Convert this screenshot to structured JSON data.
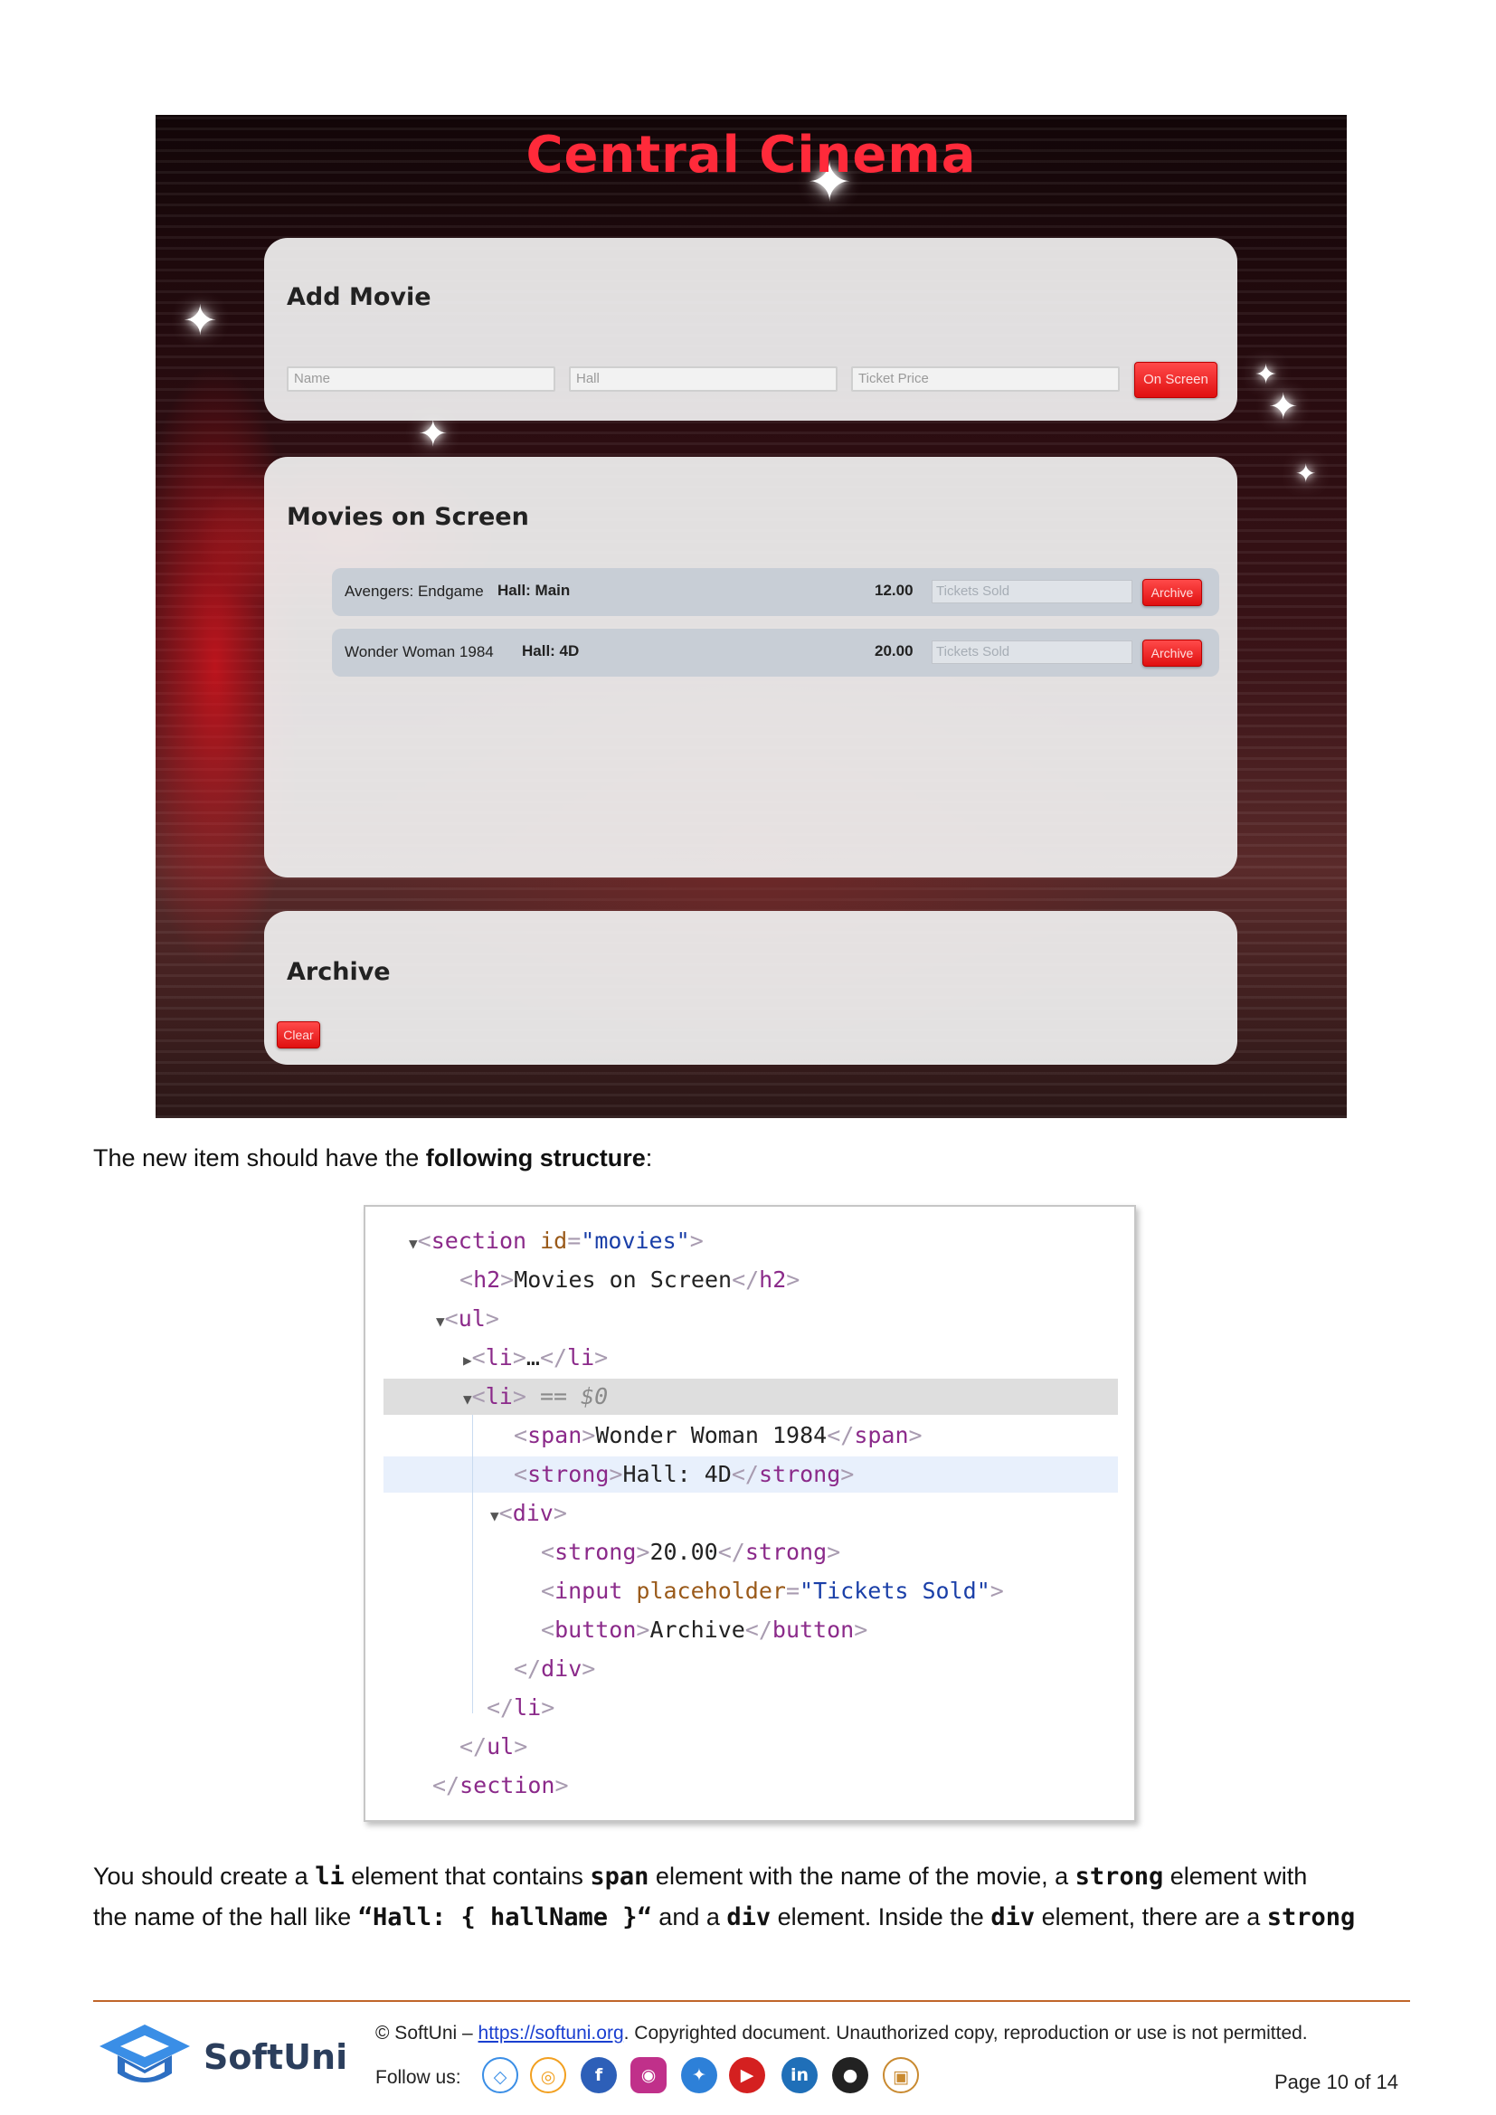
{
  "cinema_app": {
    "title": "Central Cinema",
    "add_movie": {
      "heading": "Add Movie",
      "name_placeholder": "Name",
      "hall_placeholder": "Hall",
      "price_placeholder": "Ticket Price",
      "on_screen_label": "On Screen"
    },
    "movies_on_screen": {
      "heading": "Movies on Screen",
      "movies": [
        {
          "name": "Avengers: Endgame",
          "hall": "Hall: Main",
          "price": "12.00",
          "tickets_placeholder": "Tickets Sold",
          "archive_label": "Archive"
        },
        {
          "name": "Wonder Woman 1984",
          "hall": "Hall: 4D",
          "price": "20.00",
          "tickets_placeholder": "Tickets Sold",
          "archive_label": "Archive"
        }
      ]
    },
    "archive": {
      "heading": "Archive",
      "clear_label": "Clear"
    }
  },
  "intro": {
    "before": "The new item should have the ",
    "bold": "following structure",
    "after": ":"
  },
  "code": {
    "section_open_tag": "section",
    "section_attr": "id",
    "section_attr_val": "\"movies\"",
    "h2_text": "Movies on Screen",
    "li_collapsed": "…",
    "li_selected_marker": "== $0",
    "span_text": "Wonder Woman 1984",
    "hall_text": "Hall: 4D",
    "price_text": "20.00",
    "input_attr": "placeholder",
    "input_attr_val": "\"Tickets Sold\"",
    "button_text": "Archive"
  },
  "description": {
    "t1": "You should create a ",
    "c1": "li",
    "t2": " element that contains ",
    "c2": "span",
    "t3": " element with the name of the movie, a ",
    "c3": "strong",
    "t4": " element with",
    "t5": "the name of the hall like ",
    "c4": "“Hall: { hallName }“",
    "t6": " and a ",
    "c5": "div",
    "t7": " element. Inside the ",
    "c6": "div",
    "t8": " element, there are a ",
    "c7": "strong"
  },
  "footer": {
    "copyright_prefix": "© SoftUni – ",
    "link_text": "https://softuni.org",
    "copyright_suffix": ". Copyrighted document. Unauthorized copy, reproduction or use is not permitted.",
    "follow_label": "Follow us:",
    "logo_text": "SoftUni",
    "page_label": "Page 10 of 14",
    "social_icons": [
      "softuni-icon",
      "softuni-foundation-icon",
      "facebook-icon",
      "instagram-icon",
      "twitter-icon",
      "youtube-icon",
      "linkedin-icon",
      "github-icon",
      "softuni-digital-icon"
    ]
  }
}
